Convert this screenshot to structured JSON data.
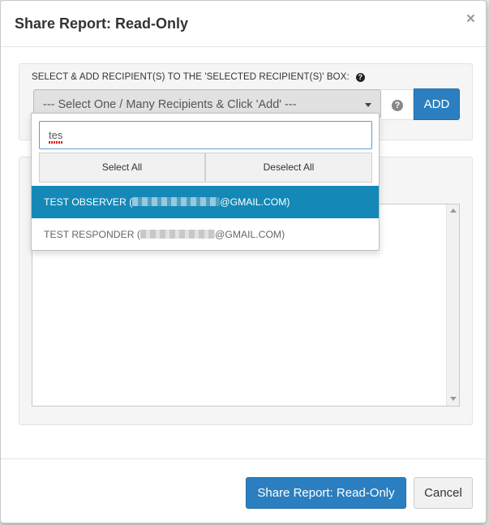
{
  "modal": {
    "title": "Share Report: Read-Only",
    "close_symbol": "×"
  },
  "recipients": {
    "instruction": "SELECT & ADD RECIPIENT(S) TO THE 'SELECTED RECIPIENT(S)' BOX:",
    "info_icon_glyph": "?",
    "select_placeholder": "--- Select One / Many Recipients & Click 'Add' ---",
    "help_icon_glyph": "?",
    "add_label": "ADD"
  },
  "dropdown": {
    "search_value": "tes",
    "select_all_label": "Select All",
    "deselect_all_label": "Deselect All",
    "options": [
      {
        "name_prefix": "TEST OBSERVER (",
        "email_suffix": "@GMAIL.COM)",
        "selected": true
      },
      {
        "name_prefix": "TEST RESPONDER (",
        "email_suffix": "@GMAIL.COM)",
        "selected": false
      }
    ]
  },
  "footer": {
    "share_label": "Share Report: Read-Only",
    "cancel_label": "Cancel"
  },
  "colors": {
    "primary": "#2b7fc0",
    "highlight": "#1489b8"
  }
}
